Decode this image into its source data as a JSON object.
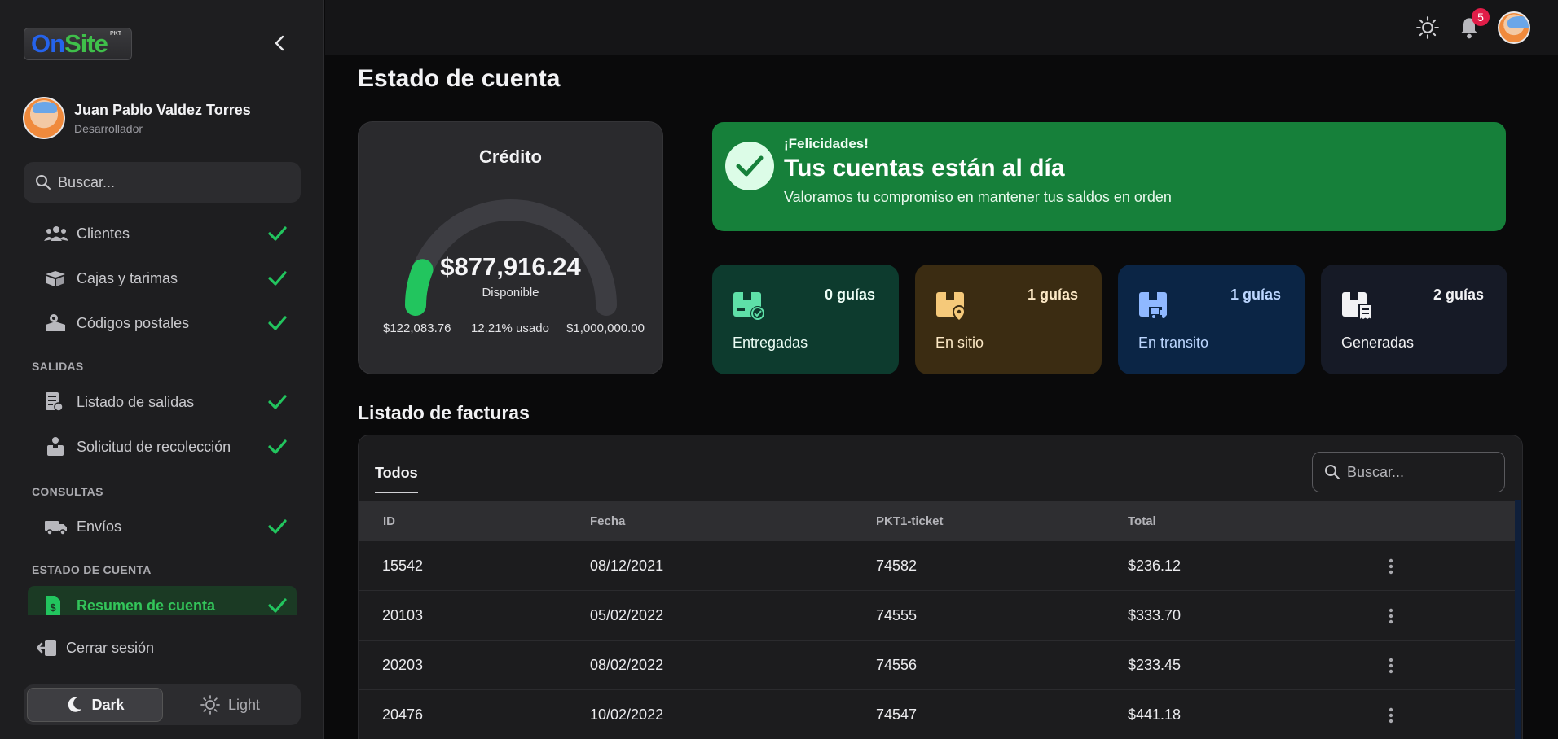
{
  "brand": {
    "logo_on": "On",
    "logo_site": "Site",
    "logo_sup": "PKT"
  },
  "user": {
    "name": "Juan Pablo Valdez Torres",
    "role": "Desarrollador"
  },
  "sidebar": {
    "search_placeholder": "Buscar...",
    "items": [
      {
        "label": "Clientes",
        "icon": "users-icon"
      },
      {
        "label": "Cajas y tarimas",
        "icon": "box-icon"
      },
      {
        "label": "Códigos postales",
        "icon": "postal-icon"
      }
    ],
    "sections": [
      {
        "title": "SALIDAS",
        "items": [
          {
            "label": "Listado de salidas"
          },
          {
            "label": "Solicitud de recolección"
          }
        ]
      },
      {
        "title": "CONSULTAS",
        "items": [
          {
            "label": "Envíos"
          }
        ]
      },
      {
        "title": "ESTADO DE CUENTA",
        "items": [
          {
            "label": "Resumen de cuenta"
          }
        ]
      }
    ],
    "logout": "Cerrar sesión",
    "theme": {
      "dark": "Dark",
      "light": "Light"
    }
  },
  "topbar": {
    "notification_count": "5"
  },
  "page": {
    "title": "Estado de cuenta"
  },
  "credit": {
    "title": "Crédito",
    "available": "$877,916.24",
    "available_label": "Disponible",
    "used": "$122,083.76",
    "used_pct": "12.21% usado",
    "used_fraction": 0.1221,
    "limit": "$1,000,000.00"
  },
  "success": {
    "kicker": "¡Felicidades!",
    "headline": "Tus cuentas están al día",
    "message": "Valoramos tu compromiso en mantener tus saldos en orden"
  },
  "stats": [
    {
      "count": "0 guías",
      "label": "Entregadas",
      "bg": "#0d3b2e",
      "color": "#ecfdf5",
      "icon_color": "#5ee0a8"
    },
    {
      "count": "1 guías",
      "label": "En sitio",
      "bg": "#3b2c12",
      "color": "#fde9c6",
      "icon_color": "#f5c97a"
    },
    {
      "count": "1 guías",
      "label": "En transito",
      "bg": "#0b2545",
      "color": "#bcd6ff",
      "icon_color": "#8fb8ff"
    },
    {
      "count": "2 guías",
      "label": "Generadas",
      "bg": "#161a26",
      "color": "#f2f2f4",
      "icon_color": "#f2f2f4"
    }
  ],
  "facturas": {
    "title": "Listado de facturas",
    "tab": "Todos",
    "search_placeholder": "Buscar...",
    "columns": [
      "ID",
      "Fecha",
      "PKT1-ticket",
      "Total"
    ],
    "rows": [
      [
        "15542",
        "08/12/2021",
        "74582",
        "$236.12"
      ],
      [
        "20103",
        "05/02/2022",
        "74555",
        "$333.70"
      ],
      [
        "20203",
        "08/02/2022",
        "74556",
        "$233.45"
      ],
      [
        "20476",
        "10/02/2022",
        "74547",
        "$441.18"
      ]
    ]
  }
}
